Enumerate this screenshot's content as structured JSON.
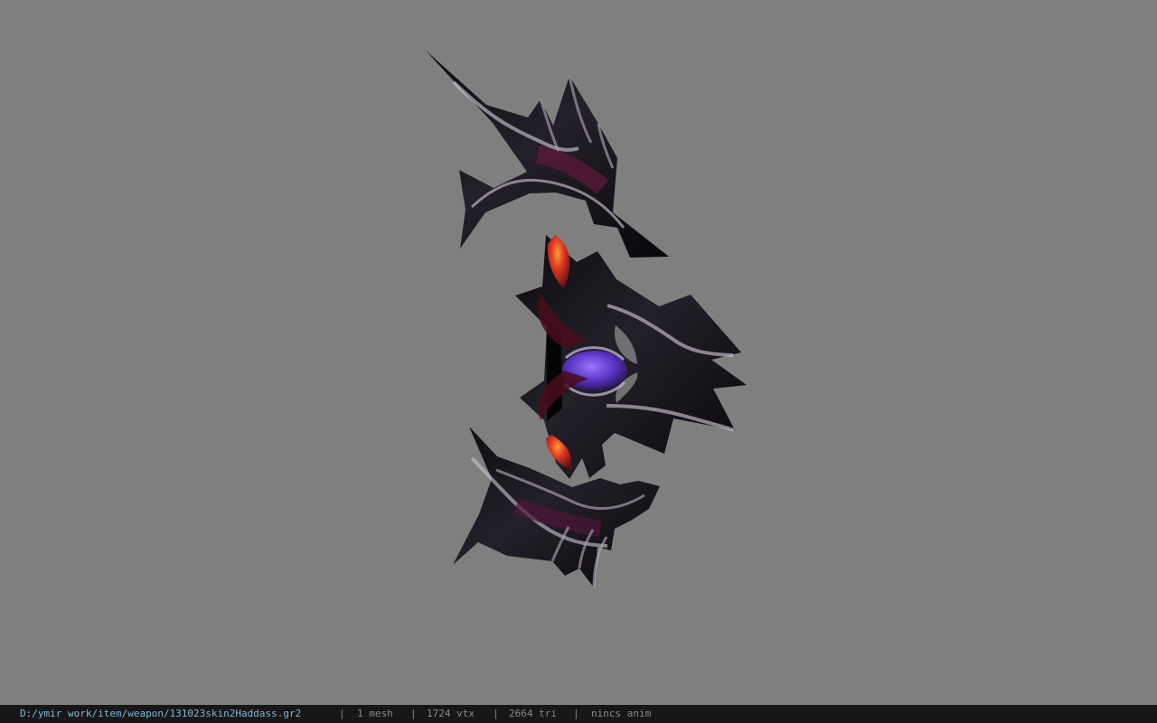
{
  "viewer": {
    "background_color": "#7f7f7f",
    "model": {
      "name": "weapon-model",
      "primary_color": "#151217",
      "edge_highlight_color": "#c8c3ce",
      "gem_color": "#6a45c7",
      "accent_red": "#d52b1f",
      "accent_orange": "#ff8d31"
    }
  },
  "status_bar": {
    "path": "D:/ymir work/item/weapon/131023skin2Haddass.gr2",
    "separator": "|",
    "meshes": "1 mesh",
    "vertices": "1724 vtx",
    "triangles": "2664 tri",
    "animation": "nincs anim",
    "background_color": "#171719",
    "path_color": "#82b7d8",
    "text_color": "#8a8a8a"
  }
}
